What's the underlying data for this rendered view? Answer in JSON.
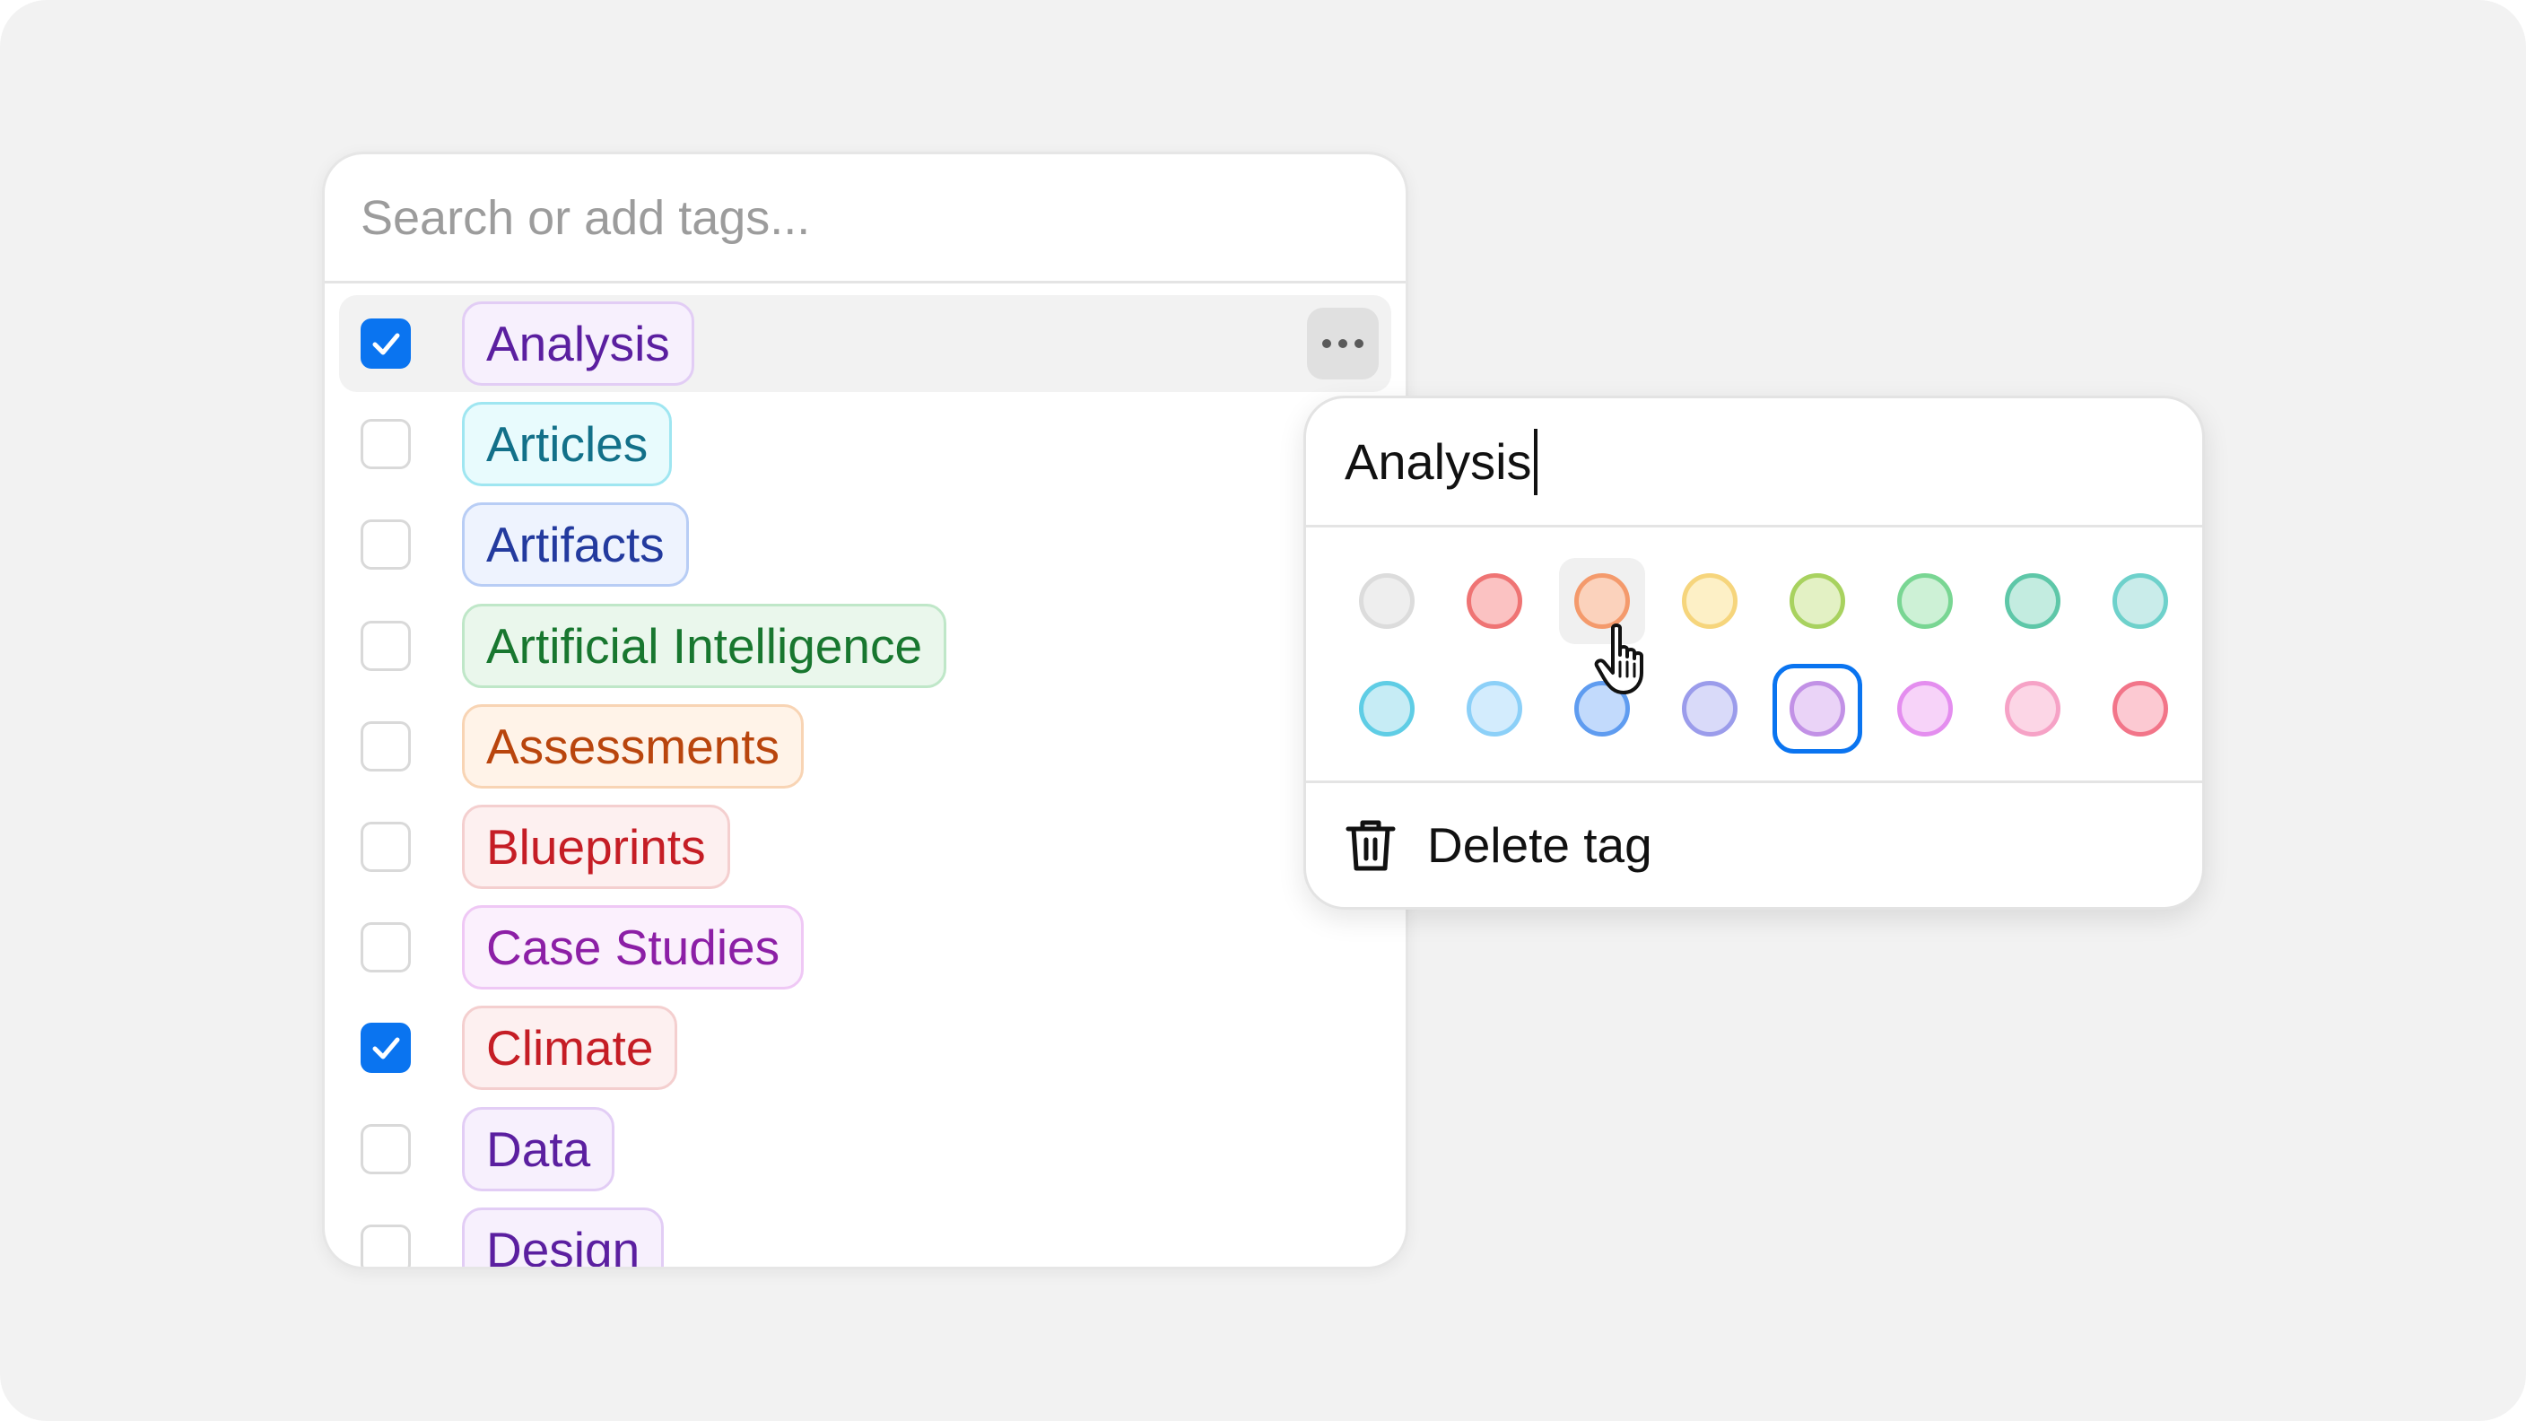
{
  "search": {
    "placeholder": "Search or add tags..."
  },
  "tags": [
    {
      "label": "Analysis",
      "checked": true,
      "text": "#5b1fa0",
      "bg": "#f7f0fd",
      "border": "#e2cdf5"
    },
    {
      "label": "Articles",
      "checked": false,
      "text": "#127089",
      "bg": "#e8fbfd",
      "border": "#9fe6f1"
    },
    {
      "label": "Artifacts",
      "checked": false,
      "text": "#233a9e",
      "bg": "#eef3fe",
      "border": "#b8cdf5"
    },
    {
      "label": "Artificial Intelligence",
      "checked": false,
      "text": "#18772f",
      "bg": "#eaf7ec",
      "border": "#bfe7c8"
    },
    {
      "label": "Assessments",
      "checked": false,
      "text": "#b9450d",
      "bg": "#fff3e8",
      "border": "#f8d4b4"
    },
    {
      "label": "Blueprints",
      "checked": false,
      "text": "#c51d25",
      "bg": "#fdf0f0",
      "border": "#f4cfcf"
    },
    {
      "label": "Case Studies",
      "checked": false,
      "text": "#8c1fa6",
      "bg": "#fbf0fd",
      "border": "#efc8f5"
    },
    {
      "label": "Climate",
      "checked": true,
      "text": "#c51d25",
      "bg": "#fdf0f0",
      "border": "#f4cfcf"
    },
    {
      "label": "Data",
      "checked": false,
      "text": "#5b1fa0",
      "bg": "#f7f0fd",
      "border": "#e2cdf5"
    },
    {
      "label": "Design",
      "checked": false,
      "text": "#5b1fa0",
      "bg": "#f7f0fd",
      "border": "#e2cdf5"
    }
  ],
  "hovered_tag_index": 0,
  "editor": {
    "tag_name": "Analysis",
    "delete_label": "Delete tag",
    "selected_color_index": 12,
    "hovered_color_index": 2,
    "colors": [
      {
        "name": "gray",
        "fill": "#eeeeee",
        "stroke": "#dcdcdc"
      },
      {
        "name": "red",
        "fill": "#fbc2c2",
        "stroke": "#ef7474"
      },
      {
        "name": "orange",
        "fill": "#fbd2bc",
        "stroke": "#f49a6c"
      },
      {
        "name": "yellow",
        "fill": "#fdf0c6",
        "stroke": "#f6d57c"
      },
      {
        "name": "lime",
        "fill": "#e3f1c4",
        "stroke": "#a8d25f"
      },
      {
        "name": "green",
        "fill": "#cdf1d6",
        "stroke": "#79d693"
      },
      {
        "name": "emerald",
        "fill": "#c3ece0",
        "stroke": "#5ec7a8"
      },
      {
        "name": "teal",
        "fill": "#c9ecea",
        "stroke": "#6ed1cb"
      },
      {
        "name": "cyan",
        "fill": "#c6ecf5",
        "stroke": "#5fcde5"
      },
      {
        "name": "sky",
        "fill": "#d3ecfd",
        "stroke": "#8cd0f8"
      },
      {
        "name": "blue",
        "fill": "#c2dafc",
        "stroke": "#5f9cf0"
      },
      {
        "name": "indigo",
        "fill": "#d9daf9",
        "stroke": "#9b9ceb"
      },
      {
        "name": "purple",
        "fill": "#ead3f7",
        "stroke": "#c291e6"
      },
      {
        "name": "fuchsia",
        "fill": "#f7d3f9",
        "stroke": "#e48eef"
      },
      {
        "name": "pink",
        "fill": "#fcd6e6",
        "stroke": "#f6a2c6"
      },
      {
        "name": "rose",
        "fill": "#fcc9d2",
        "stroke": "#f27589"
      }
    ]
  },
  "accent": "#0a74f0"
}
